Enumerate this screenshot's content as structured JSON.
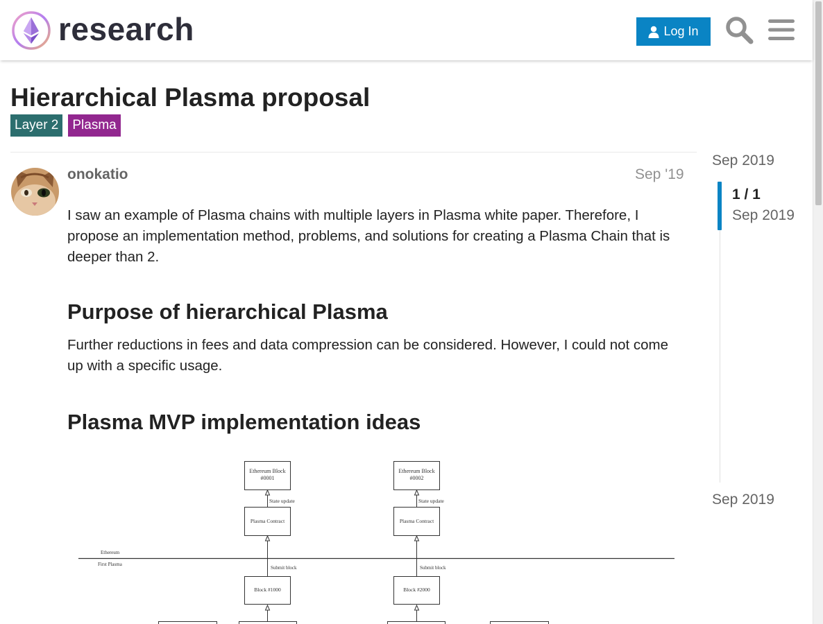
{
  "header": {
    "logo_text": "research",
    "login_label": "Log In",
    "icons": {
      "logo": "ethereum-logo-icon",
      "user": "user-icon",
      "search": "search-icon",
      "menu": "hamburger-menu-icon"
    }
  },
  "topic": {
    "title": "Hierarchical Plasma proposal",
    "tags": [
      "Layer 2",
      "Plasma"
    ],
    "tag_colors": [
      "#2c6e6e",
      "#92278f"
    ]
  },
  "post": {
    "username": "onokatio",
    "date": "Sep '19",
    "paragraph1": "I saw an example of Plasma chains with multiple layers in Plasma white paper. Therefore, I propose an implementation method, problems, and solutions for creating a Plasma Chain that is deeper than 2.",
    "heading1": "Purpose of hierarchical Plasma",
    "paragraph2": "Further reductions in fees and data compression can be considered. However, I could not come up with a specific usage.",
    "heading2": "Plasma MVP implementation ideas",
    "diagram": {
      "eth_block_1_line1": "Ethereum Block",
      "eth_block_1_line2": "#0001",
      "eth_block_2_line1": "Ethereum Block",
      "eth_block_2_line2": "#0002",
      "state_update": "State update",
      "plasma_contract": "Plasma Contract",
      "layer_top": "Ethereum",
      "layer_bottom": "First Plasma",
      "submit_block": "Submit block",
      "block_1000": "Block #1000",
      "block_2000": "Block #2000"
    }
  },
  "timeline": {
    "top_date": "Sep 2019",
    "position": "1 / 1",
    "position_date": "Sep 2019",
    "bottom_date": "Sep 2019"
  },
  "colors": {
    "accent": "#0a84c4",
    "header_text": "#2e2e3a"
  }
}
